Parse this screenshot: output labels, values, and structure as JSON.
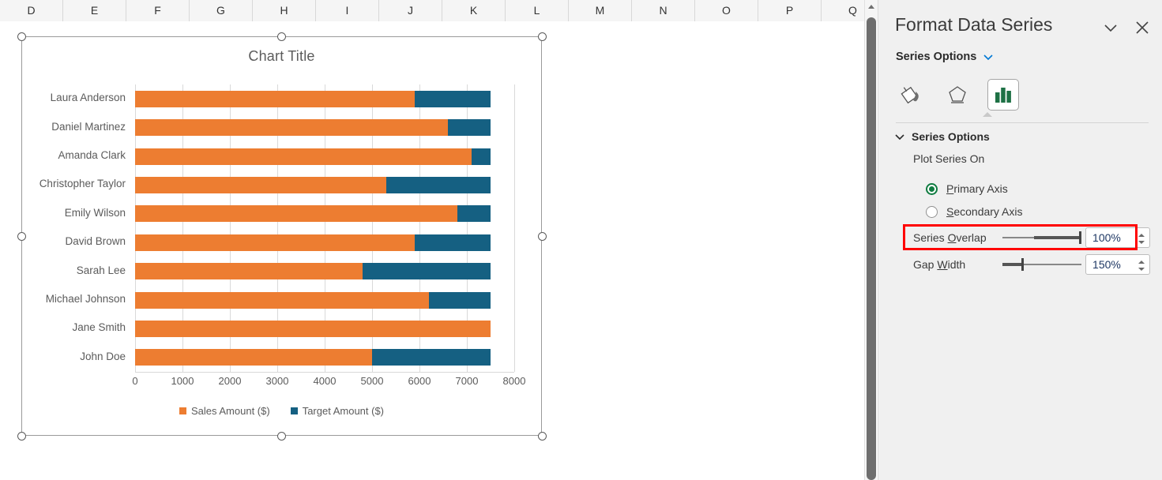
{
  "spreadsheet": {
    "columns": [
      "D",
      "E",
      "F",
      "G",
      "H",
      "I",
      "J",
      "K",
      "L",
      "M",
      "N",
      "O",
      "P",
      "Q"
    ],
    "scrollbar": {
      "up_arrow": "scroll-up-arrow"
    }
  },
  "chart": {
    "title": "Chart Title",
    "handles": [
      "top-left",
      "top-center",
      "top-right",
      "middle-left",
      "middle-right",
      "bottom-left",
      "bottom-center",
      "bottom-right"
    ]
  },
  "chart_data": {
    "type": "bar",
    "title": "Chart Title",
    "orientation": "horizontal",
    "stacked": true,
    "xlabel": "",
    "ylabel": "",
    "xlim": [
      0,
      8000
    ],
    "xticks": [
      "0",
      "1000",
      "2000",
      "3000",
      "4000",
      "5000",
      "6000",
      "7000",
      "8000"
    ],
    "grid": true,
    "legend_position": "bottom",
    "categories": [
      "Laura Anderson",
      "Daniel Martinez",
      "Amanda Clark",
      "Christopher Taylor",
      "Emily Wilson",
      "David Brown",
      "Sarah Lee",
      "Michael Johnson",
      "Jane Smith",
      "John Doe"
    ],
    "series": [
      {
        "name": "Sales Amount ($)",
        "color": "#ED7D31",
        "values": [
          5900,
          6600,
          7100,
          5300,
          6800,
          5900,
          4800,
          6200,
          7500,
          5000
        ]
      },
      {
        "name": "Target Amount ($)",
        "color": "#156082",
        "values": [
          1600,
          900,
          400,
          2200,
          700,
          1600,
          2700,
          1300,
          0,
          2500
        ]
      }
    ],
    "totals": [
      7500,
      7500,
      7500,
      7500,
      7500,
      7500,
      7500,
      7500,
      7500,
      7500
    ]
  },
  "pane": {
    "title": "Format Data Series",
    "collapse_icon": "chevron-down-icon",
    "close_icon": "close-icon",
    "subtitle": "Series Options",
    "subtitle_chevron": "chevron-down-icon",
    "icons": [
      {
        "name": "fill-and-line-icon",
        "selected": false
      },
      {
        "name": "effects-icon",
        "selected": false
      },
      {
        "name": "series-options-icon",
        "selected": true
      }
    ],
    "section": {
      "header": "Series Options",
      "header_chevron": "chevron-down-icon",
      "plot_series_on_label": "Plot Series On",
      "radios": [
        {
          "label": "Primary Axis",
          "accesskey": "P",
          "checked": true
        },
        {
          "label": "Secondary Axis",
          "accesskey": "S",
          "checked": false
        }
      ],
      "controls": [
        {
          "label_before": "Series ",
          "label_key": "O",
          "label_after": "verlap",
          "value": "100%",
          "slider_pos": 100,
          "highlighted": true
        },
        {
          "label_before": "Gap ",
          "label_key": "W",
          "label_after": "idth",
          "value": "150%",
          "slider_pos": 25,
          "highlighted": false
        }
      ]
    },
    "colors": {
      "accent_green": "#107C41",
      "highlight_red": "#ff0000",
      "value_text": "#1F3864"
    }
  }
}
